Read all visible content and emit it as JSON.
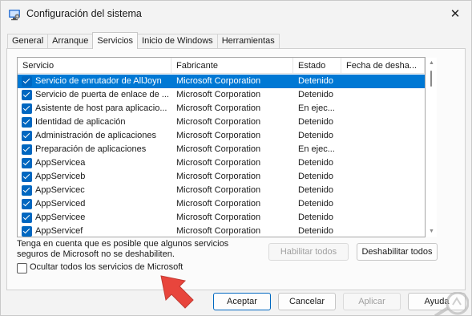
{
  "window": {
    "title": "Configuración del sistema"
  },
  "tabs": [
    {
      "label": "General",
      "active": false
    },
    {
      "label": "Arranque",
      "active": false
    },
    {
      "label": "Servicios",
      "active": true
    },
    {
      "label": "Inicio de Windows",
      "active": false
    },
    {
      "label": "Herramientas",
      "active": false
    }
  ],
  "table": {
    "columns": [
      "Servicio",
      "Fabricante",
      "Estado",
      "Fecha de desha..."
    ],
    "rows": [
      {
        "service": "Servicio de enrutador de AllJoyn",
        "manufacturer": "Microsoft Corporation",
        "status": "Detenido",
        "checked": true,
        "selected": true
      },
      {
        "service": "Servicio de puerta de enlace de ...",
        "manufacturer": "Microsoft Corporation",
        "status": "Detenido",
        "checked": true,
        "selected": false
      },
      {
        "service": "Asistente de host para aplicacio...",
        "manufacturer": "Microsoft Corporation",
        "status": "En ejec...",
        "checked": true,
        "selected": false
      },
      {
        "service": "Identidad de aplicación",
        "manufacturer": "Microsoft Corporation",
        "status": "Detenido",
        "checked": true,
        "selected": false
      },
      {
        "service": "Administración de aplicaciones",
        "manufacturer": "Microsoft Corporation",
        "status": "Detenido",
        "checked": true,
        "selected": false
      },
      {
        "service": "Preparación de aplicaciones",
        "manufacturer": "Microsoft Corporation",
        "status": "En ejec...",
        "checked": true,
        "selected": false
      },
      {
        "service": "AppServicea",
        "manufacturer": "Microsoft Corporation",
        "status": "Detenido",
        "checked": true,
        "selected": false
      },
      {
        "service": "AppServiceb",
        "manufacturer": "Microsoft Corporation",
        "status": "Detenido",
        "checked": true,
        "selected": false
      },
      {
        "service": "AppServicec",
        "manufacturer": "Microsoft Corporation",
        "status": "Detenido",
        "checked": true,
        "selected": false
      },
      {
        "service": "AppServiced",
        "manufacturer": "Microsoft Corporation",
        "status": "Detenido",
        "checked": true,
        "selected": false
      },
      {
        "service": "AppServicee",
        "manufacturer": "Microsoft Corporation",
        "status": "Detenido",
        "checked": true,
        "selected": false
      },
      {
        "service": "AppServicef",
        "manufacturer": "Microsoft Corporation",
        "status": "Detenido",
        "checked": true,
        "selected": false
      }
    ]
  },
  "note": {
    "line1": "Tenga en cuenta que es posible que algunos servicios",
    "line2": "seguros de Microsoft no se deshabiliten."
  },
  "buttons": {
    "enable_all": "Habilitar todos",
    "disable_all": "Deshabilitar todos",
    "accept": "Aceptar",
    "cancel": "Cancelar",
    "apply": "Aplicar",
    "help": "Ayuda"
  },
  "hide_ms_services": {
    "label": "Ocultar todos los servicios de Microsoft",
    "checked": false
  },
  "icons": {
    "app": "system-config-icon",
    "close": "close-icon",
    "pointer_arrow": "red-arrow-icon",
    "watermark": "solvetic-logo-icon"
  },
  "colors": {
    "selection": "#0078d4",
    "checkbox": "#0067c0",
    "arrow": "#e8453c"
  }
}
